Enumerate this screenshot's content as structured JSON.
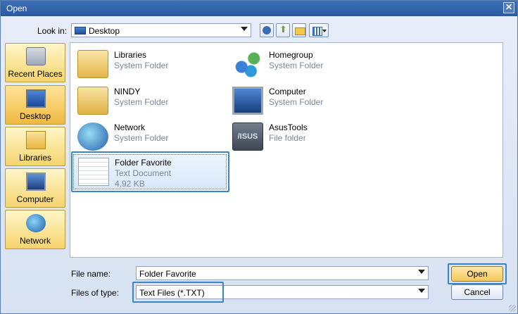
{
  "window": {
    "title": "Open",
    "close_glyph": "✕"
  },
  "lookin": {
    "label": "Look in:",
    "value": "Desktop",
    "icon": "desktop-icon"
  },
  "toolbar": {
    "back_icon": "back-icon",
    "up_icon": "up-folder-icon",
    "new_folder_icon": "new-folder-icon",
    "view_menu_icon": "view-menu-icon"
  },
  "places": [
    {
      "label": "Recent Places",
      "icon": "recent-places-icon"
    },
    {
      "label": "Desktop",
      "icon": "desktop-icon",
      "selected": true
    },
    {
      "label": "Libraries",
      "icon": "libraries-icon"
    },
    {
      "label": "Computer",
      "icon": "computer-icon"
    },
    {
      "label": "Network",
      "icon": "network-icon"
    }
  ],
  "items": [
    {
      "name": "Libraries",
      "type": "System Folder",
      "icon": "libraries-icon"
    },
    {
      "name": "Homegroup",
      "type": "System Folder",
      "icon": "homegroup-icon"
    },
    {
      "name": "NINDY",
      "type": "System Folder",
      "icon": "user-folder-icon"
    },
    {
      "name": "Computer",
      "type": "System Folder",
      "icon": "computer-icon"
    },
    {
      "name": "Network",
      "type": "System Folder",
      "icon": "network-icon"
    },
    {
      "name": "AsusTools",
      "type": "File folder",
      "icon": "asus-folder-icon"
    },
    {
      "name": "Folder Favorite",
      "type": "Text Document",
      "size": "4,92 KB",
      "icon": "text-document-icon",
      "selected": true
    }
  ],
  "asus_logo_text": "/ISUS",
  "filename": {
    "label": "File name:",
    "value": "Folder Favorite"
  },
  "filetype": {
    "label": "Files of type:",
    "value": "Text Files (*.TXT)"
  },
  "buttons": {
    "open": "Open",
    "cancel": "Cancel"
  },
  "colors": {
    "title_bar": "#2a5aa1",
    "highlight": "#3a85c8",
    "selection": "#d8e8fa"
  }
}
